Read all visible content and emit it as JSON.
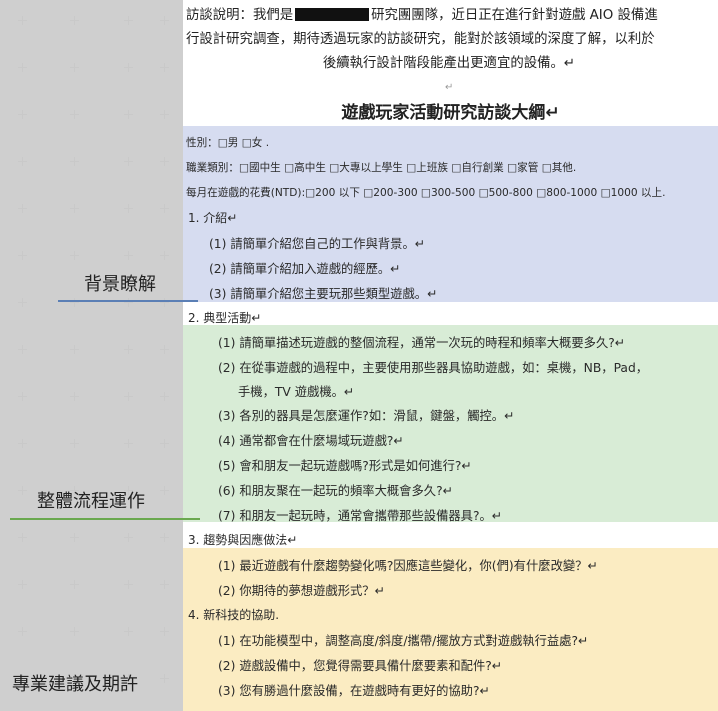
{
  "intro": {
    "line1_a": "訪談說明：我們是",
    "line1_b": "研究團團隊，近日正在進行針對遊戲 AIO 設備進",
    "line2": "行設計研究調查，期待透過玩家的訪談研究，能對於該領域的深度了解，以利於",
    "line3": "後續執行設計階段能產出更適宜的設備。↵",
    "blank": "↵"
  },
  "title": "遊戲玩家活動研究訪談大綱↵",
  "profile": {
    "gender": "性別：□男 □女 .",
    "occupation": "職業類別：□國中生 □高中生 □大專以上學生 □上班族 □自行創業 □家管 □其他.",
    "spending": "每月在遊戲的花費(NTD):□200 以下 □200-300 □300-500 □500-800 □800-1000 □1000 以上."
  },
  "sections": [
    {
      "heading": "1.  介紹↵",
      "items": [
        "(1) 請簡單介紹您自己的工作與背景。↵",
        "(2) 請簡單介紹加入遊戲的經歷。↵",
        "(3) 請簡單介紹您主要玩那些類型遊戲。↵"
      ]
    },
    {
      "heading": "2.  典型活動↵",
      "items": [
        "(1) 請簡單描述玩遊戲的整個流程，通常一次玩的時程和頻率大概要多久?↵",
        "(2) 在從事遊戲的過程中，主要使用那些器具協助遊戲，如：桌機，NB，Pad，",
        "手機，TV 遊戲機。↵",
        "(3) 各別的器具是怎麼運作?如：滑鼠，鍵盤，觸控。↵",
        "(4) 通常都會在什麼場域玩遊戲?↵",
        "(5) 會和朋友一起玩遊戲嗎?形式是如何進行?↵",
        "(6) 和朋友聚在一起玩的頻率大概會多久?↵",
        "(7) 和朋友一起玩時，通常會攜帶那些設備器具?。↵"
      ]
    },
    {
      "heading": "3.  趨勢與因應做法↵",
      "items": [
        "(1) 最近遊戲有什麼趨勢變化嗎?因應這些變化，你(們)有什麼改變？↵",
        "(2) 你期待的夢想遊戲形式？↵"
      ]
    },
    {
      "heading": "4.  新科技的協助.",
      "items": [
        "(1) 在功能模型中，調整高度/斜度/攜帶/擺放方式對遊戲執行益處?↵",
        "(2) 遊戲設備中，您覺得需要具備什麼要素和配件?↵",
        "(3) 您有勝過什麼設備，在遊戲時有更好的協助?↵"
      ]
    }
  ],
  "labels": {
    "background": "背景瞭解",
    "workflow": "整體流程運作",
    "advice": "專業建議及期許"
  },
  "colors": {
    "blue_band": "#d6dcf0",
    "green_band": "#d8ecd6",
    "yellow_band": "#fbecc2",
    "rule_blue": "#5b7fb5",
    "rule_green": "#6aa84f",
    "rule_yellow": "#c9a227"
  }
}
